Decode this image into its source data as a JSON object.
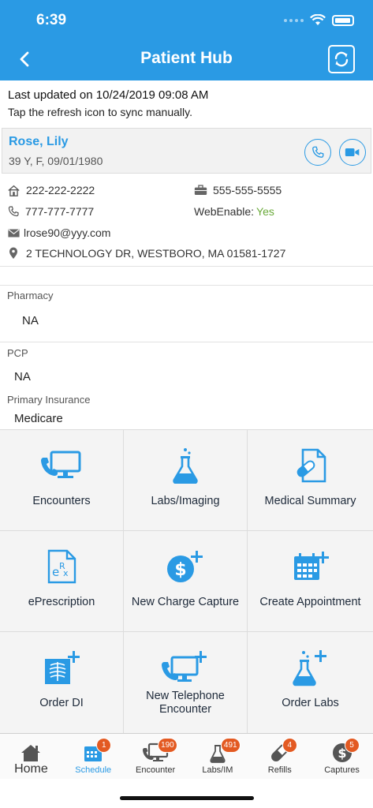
{
  "status": {
    "time": "6:39"
  },
  "header": {
    "title": "Patient Hub"
  },
  "sync": {
    "last_updated": "Last updated on 10/24/2019 09:08 AM",
    "hint": "Tap the refresh icon to sync manually."
  },
  "patient": {
    "name": "Rose, Lily",
    "details": "39 Y, F, 09/01/1980"
  },
  "contact": {
    "home_phone": "222-222-2222",
    "work_phone": "555-555-5555",
    "mobile_phone": "777-777-7777",
    "web_enable_label": "WebEnable:",
    "web_enable_value": "Yes",
    "email": "lrose90@yyy.com",
    "address": "2 TECHNOLOGY DR, WESTBORO, MA 01581-1727"
  },
  "info": {
    "pharmacy_label": "Pharmacy",
    "pharmacy_value": "NA",
    "pcp_label": "PCP",
    "pcp_value": "NA",
    "insurance_label": "Primary Insurance",
    "insurance_value": "Medicare"
  },
  "tiles": [
    {
      "label": "Encounters",
      "icon": "encounters-icon"
    },
    {
      "label": "Labs/Imaging",
      "icon": "labs-flask-icon"
    },
    {
      "label": "Medical Summary",
      "icon": "medical-summary-icon"
    },
    {
      "label": "ePrescription",
      "icon": "eprescription-icon"
    },
    {
      "label": "New Charge Capture",
      "icon": "charge-capture-icon"
    },
    {
      "label": "Create Appointment",
      "icon": "create-appointment-icon"
    },
    {
      "label": "Order DI",
      "icon": "order-di-icon"
    },
    {
      "label": "New Telephone Encounter",
      "icon": "telephone-encounter-icon"
    },
    {
      "label": "Order Labs",
      "icon": "order-labs-icon"
    }
  ],
  "tabs": [
    {
      "label": "Home",
      "badge": ""
    },
    {
      "label": "Schedule",
      "badge": "1"
    },
    {
      "label": "Encounter",
      "badge": "190"
    },
    {
      "label": "Labs/IM",
      "badge": "491"
    },
    {
      "label": "Refills",
      "badge": "4"
    },
    {
      "label": "Captures",
      "badge": "5"
    }
  ],
  "colors": {
    "brand": "#2a9ae4",
    "badge": "#e35a22",
    "success": "#6aaa3a"
  }
}
